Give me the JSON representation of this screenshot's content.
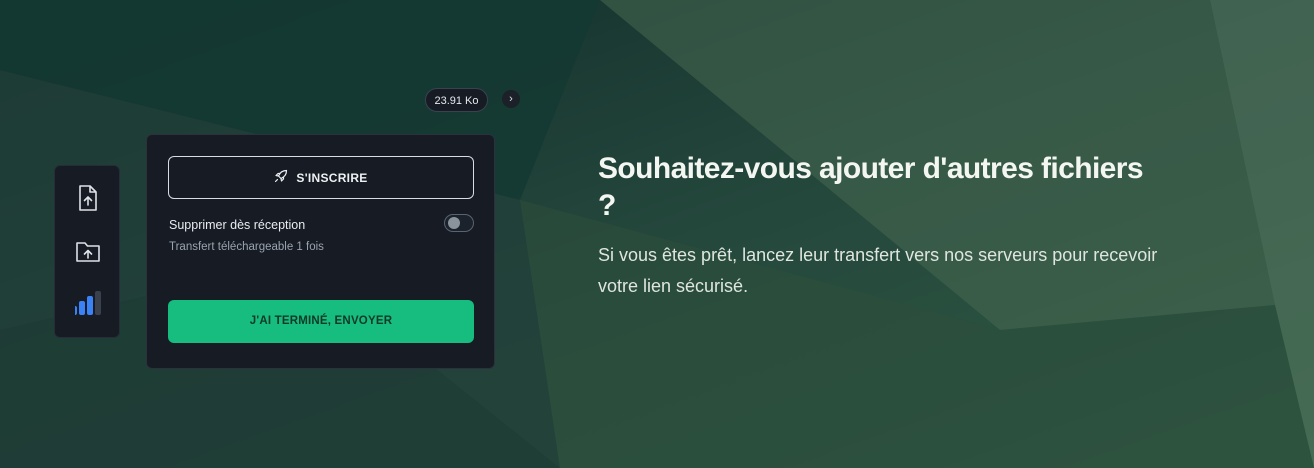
{
  "transfer": {
    "size_label": "23.91 Ko",
    "next_icon": "chevron-right-icon"
  },
  "sidebar": {
    "items": [
      {
        "name": "upload-file",
        "icon": "file-upload-icon"
      },
      {
        "name": "upload-folder",
        "icon": "folder-upload-icon"
      },
      {
        "name": "signal",
        "icon": "signal-bars-icon"
      }
    ]
  },
  "panel": {
    "signup_label": "S'INSCRIRE",
    "signup_icon": "rocket-icon",
    "delete_on_receipt_label": "Supprimer dès réception",
    "delete_on_receipt_enabled": false,
    "download_note": "Transfert téléchargeable 1 fois",
    "send_label": "J'AI TERMINÉ, ENVOYER"
  },
  "hero": {
    "title": "Souhaitez-vous ajouter d'autres fichiers ?",
    "description": "Si vous êtes prêt, lancez leur transfert vers nos serveurs pour recevoir votre lien sécurisé."
  },
  "colors": {
    "accent": "#17bd7f",
    "panel_bg": "#161b24",
    "signal_blue": "#3b82f6"
  }
}
